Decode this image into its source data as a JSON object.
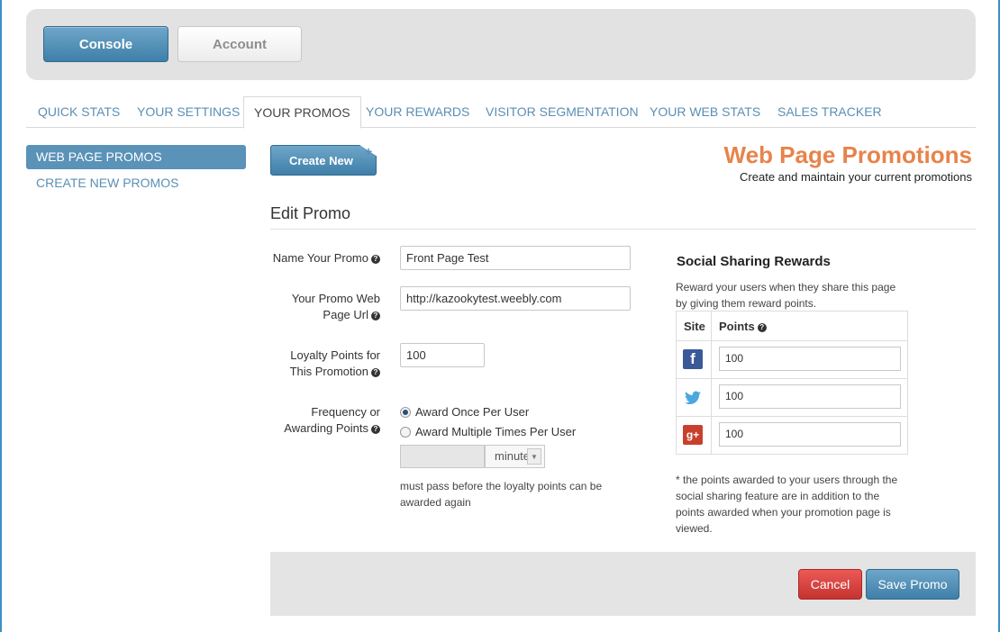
{
  "header": {
    "console_label": "Console",
    "account_label": "Account"
  },
  "tabs": [
    {
      "label": "QUICK STATS"
    },
    {
      "label": "YOUR SETTINGS"
    },
    {
      "label": "YOUR PROMOS",
      "active": true
    },
    {
      "label": "YOUR REWARDS"
    },
    {
      "label": "VISITOR SEGMENTATION"
    },
    {
      "label": "YOUR WEB STATS"
    },
    {
      "label": "SALES TRACKER"
    }
  ],
  "sidebar": {
    "items": [
      {
        "label": "WEB PAGE PROMOS",
        "active": true
      },
      {
        "label": "CREATE NEW PROMOS"
      }
    ]
  },
  "main": {
    "create_new_label": "Create New",
    "title": "Web Page Promotions",
    "subtitle": "Create and maintain your current promotions",
    "section_title": "Edit Promo"
  },
  "form": {
    "name_label": "Name Your Promo",
    "name_value": "Front Page Test",
    "url_label_line1": "Your Promo Web",
    "url_label_line2": "Page Url",
    "url_value": "http://kazookytest.weebly.com",
    "points_label_line1": "Loyalty Points for",
    "points_label_line2": "This Promotion",
    "points_value": "100",
    "freq_label_line1": "Frequency or",
    "freq_label_line2": "Awarding Points",
    "radio_once": "Award Once Per User",
    "radio_multiple": "Award Multiple Times Per User",
    "interval_value": "",
    "interval_unit": "minutes",
    "interval_help": "must pass before the loyalty points can be awarded again"
  },
  "social": {
    "title": "Social Sharing Rewards",
    "description": "Reward your users when they share this page by giving them reward points.",
    "col_site": "Site",
    "col_points": "Points",
    "rows": [
      {
        "site": "facebook",
        "points": "100"
      },
      {
        "site": "twitter",
        "points": "100"
      },
      {
        "site": "google-plus",
        "points": "100"
      }
    ],
    "note": "* the points awarded to your users through the social sharing feature are in addition to the points awarded when your promotion page is viewed."
  },
  "footer": {
    "cancel_label": "Cancel",
    "save_label": "Save Promo"
  },
  "colors": {
    "accent_blue": "#5a92b8",
    "title_orange": "#e8834a",
    "cancel_red": "#d9403c"
  }
}
